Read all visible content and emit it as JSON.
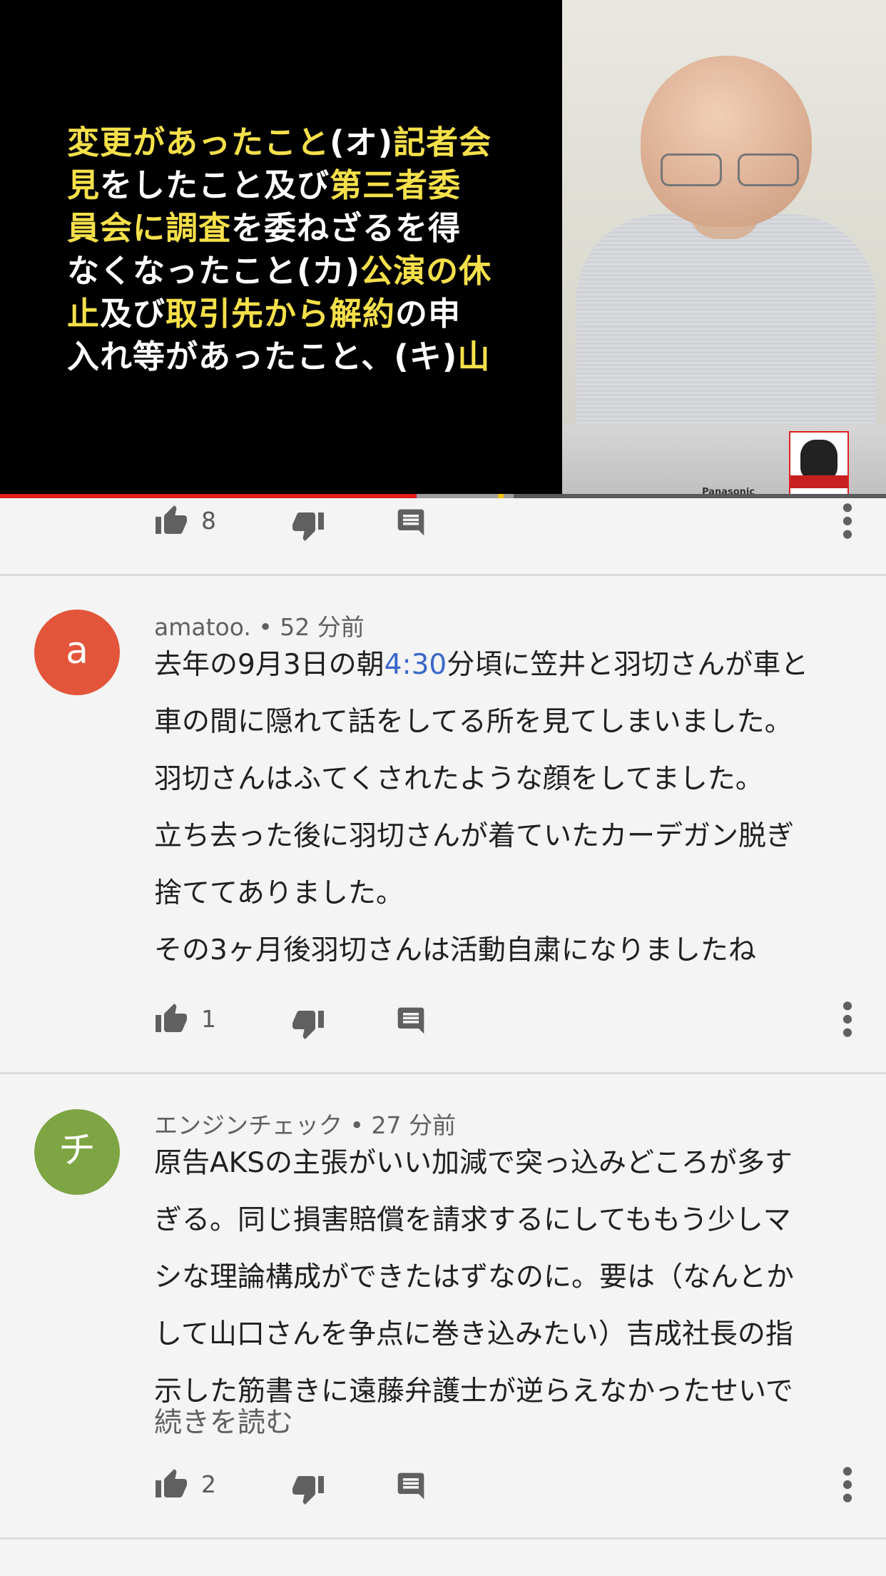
{
  "video": {
    "slide_lines": [
      [
        {
          "t": "変更があったこと",
          "h": true
        },
        {
          "t": "(オ)",
          "h": false
        },
        {
          "t": "記者会",
          "h": true
        }
      ],
      [
        {
          "t": "見",
          "h": true
        },
        {
          "t": "をしたこと及び",
          "h": false
        },
        {
          "t": "第三者委",
          "h": true
        }
      ],
      [
        {
          "t": "員会に調査",
          "h": true
        },
        {
          "t": "を委ねざるを得",
          "h": false
        }
      ],
      [
        {
          "t": "なくなったこと(カ)",
          "h": false
        },
        {
          "t": "公演の休",
          "h": true
        }
      ],
      [
        {
          "t": "止",
          "h": true
        },
        {
          "t": "及び",
          "h": false
        },
        {
          "t": "取引先から解約",
          "h": true
        },
        {
          "t": "の申",
          "h": false
        }
      ],
      [
        {
          "t": "入れ等があったこと、(キ)",
          "h": false
        },
        {
          "t": "山",
          "h": true
        }
      ]
    ],
    "laptop_brand": "Panasonic",
    "progress_played": 0.47,
    "progress_buffered": 0.58,
    "colors": {
      "played": "#e21b1b",
      "highlight": "#f5e04a"
    }
  },
  "comments": [
    {
      "actions": {
        "like_count": "8"
      }
    },
    {
      "avatar_letter": "a",
      "avatar_color": "#e2553a",
      "author": "amatoo.",
      "time": "52 分前",
      "lines": [
        {
          "pre": "去年の9月3日の朝",
          "ts": "4:30",
          "post": "分頃に笠井と羽切さんが車と"
        },
        {
          "pre": "車の間に隠れて話をしてる所を見てしまいました。"
        },
        {
          "pre": "羽切さんはふてくされたような顔をしてました。"
        },
        {
          "pre": "立ち去った後に羽切さんが着ていたカーデガン脱ぎ"
        },
        {
          "pre": "捨ててありました。"
        },
        {
          "pre": "その3ヶ月後羽切さんは活動自粛になりましたね"
        }
      ],
      "actions": {
        "like_count": "1"
      }
    },
    {
      "avatar_letter": "チ",
      "avatar_color": "#7ea543",
      "author": "エンジンチェック",
      "time": "27 分前",
      "lines": [
        {
          "pre": "原告AKSの主張がいい加減で突っ込みどころが多す"
        },
        {
          "pre": "ぎる。同じ損害賠償を請求するにしてももう少しマ"
        },
        {
          "pre": "シな理論構成ができたはずなのに。要は（なんとか"
        },
        {
          "pre": "して山口さんを争点に巻き込みたい）吉成社長の指"
        },
        {
          "pre": "示した筋書きに遠藤弁護士が逆らえなかったせいで"
        }
      ],
      "read_more": "続きを読む",
      "actions": {
        "like_count": "2"
      }
    }
  ],
  "icons": {
    "like": "thumbs-up-icon",
    "dislike": "thumbs-down-icon",
    "reply": "comment-icon",
    "more": "more-vert-icon"
  },
  "separator": "•"
}
